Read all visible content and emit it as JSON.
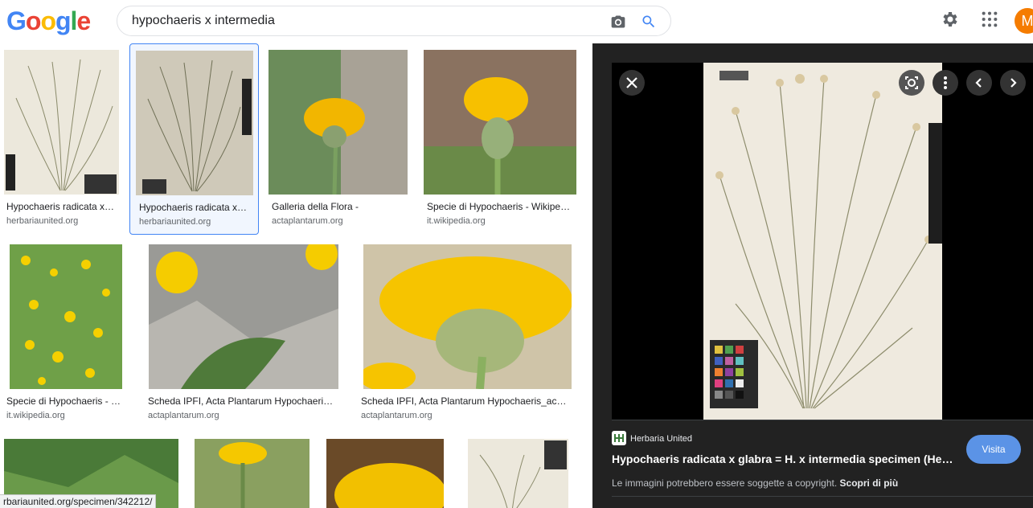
{
  "search": {
    "query": "hypochaeris x intermedia"
  },
  "header": {
    "logo_letters": [
      "G",
      "o",
      "o",
      "g",
      "l",
      "e"
    ],
    "logo_colors": [
      "#4285f4",
      "#ea4335",
      "#fbbc05",
      "#4285f4",
      "#34a853",
      "#ea4335"
    ],
    "avatar_initial": "M",
    "avatar_color": "#f57c00"
  },
  "results": [
    {
      "caption": "Hypochaeris radicata x…",
      "source": "herbariaunited.org"
    },
    {
      "caption": "Hypochaeris radicata x…",
      "source": "herbariaunited.org",
      "selected": true
    },
    {
      "caption": "Galleria della Flora -",
      "source": "actaplantarum.org"
    },
    {
      "caption": "Specie di Hypochaeris - Wikipe…",
      "source": "it.wikipedia.org"
    },
    {
      "caption": "Specie di Hypochaeris - …",
      "source": "it.wikipedia.org"
    },
    {
      "caption": "Scheda IPFI, Acta Plantarum Hypochaeri…",
      "source": "actaplantarum.org"
    },
    {
      "caption": "Scheda IPFI, Acta Plantarum Hypochaeris_ach…",
      "source": "actaplantarum.org"
    }
  ],
  "status_url": "rbariaunited.org/specimen/342212/",
  "preview": {
    "source_name": "Herbaria United",
    "title": "Hypochaeris radicata x glabra = H. x intermedia specimen (He…",
    "copyright_text": "Le immagini potrebbero essere soggette a copyright.",
    "learn_more": "Scopri di più",
    "visit_label": "Visita"
  },
  "colors": {
    "accent_blue": "#4285f4",
    "visit_button": "#5b93e6",
    "panel_bg": "#222222"
  }
}
